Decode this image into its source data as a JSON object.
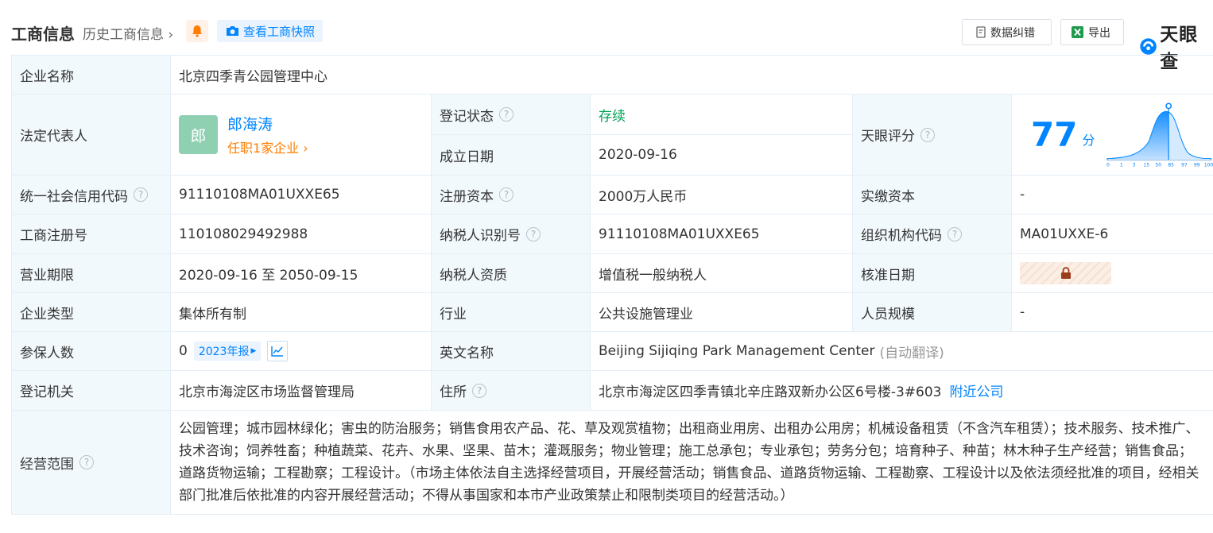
{
  "header": {
    "title": "工商信息",
    "history_link": "历史工商信息",
    "snapshot_label": "查看工商快照",
    "correct_label": "数据纠错",
    "export_label": "导出",
    "logo_text": "天眼查"
  },
  "company": {
    "name_label": "企业名称",
    "name": "北京四季青公园管理中心",
    "legal_rep_label": "法定代表人",
    "legal_rep_avatar": "郎",
    "legal_rep_name": "郎海涛",
    "legal_rep_positions": "任职1家企业",
    "status_label": "登记状态",
    "status": "存续",
    "established_label": "成立日期",
    "established": "2020-09-16",
    "score_label": "天眼评分",
    "score": "77",
    "score_unit": "分",
    "score_axis_ticks": [
      "0",
      "1",
      "3",
      "15",
      "50",
      "85",
      "97",
      "99",
      "100"
    ],
    "credit_code_label": "统一社会信用代码",
    "credit_code": "91110108MA01UXXE65",
    "reg_capital_label": "注册资本",
    "reg_capital": "2000万人民币",
    "paid_capital_label": "实缴资本",
    "paid_capital": "-",
    "reg_number_label": "工商注册号",
    "reg_number": "110108029492988",
    "taxpayer_id_label": "纳税人识别号",
    "taxpayer_id": "91110108MA01UXXE65",
    "org_code_label": "组织机构代码",
    "org_code": "MA01UXXE-6",
    "term_label": "营业期限",
    "term": "2020-09-16 至 2050-09-15",
    "taxpayer_type_label": "纳税人资质",
    "taxpayer_type": "增值税一般纳税人",
    "approval_date_label": "核准日期",
    "company_type_label": "企业类型",
    "company_type": "集体所有制",
    "industry_label": "行业",
    "industry": "公共设施管理业",
    "staff_size_label": "人员规模",
    "staff_size": "-",
    "insured_label": "参保人数",
    "insured": "0",
    "report_badge": "2023年报",
    "english_name_label": "英文名称",
    "english_name": "Beijing Sijiqing Park Management Center",
    "auto_translate": "(自动翻译)",
    "authority_label": "登记机关",
    "authority": "北京市海淀区市场监督管理局",
    "address_label": "住所",
    "address": "北京市海淀区四季青镇北辛庄路双新办公区6号楼-3#603",
    "nearby_link": "附近公司",
    "scope_label": "经营范围",
    "scope": "公园管理；城市园林绿化；害虫的防治服务；销售食用农产品、花、草及观赏植物；出租商业用房、出租办公用房；机械设备租赁（不含汽车租赁）；技术服务、技术推广、技术咨询；饲养牲畜；种植蔬菜、花卉、水果、坚果、苗木；灌溉服务；物业管理；施工总承包；专业承包；劳务分包；培育种子、种苗；林木种子生产经营；销售食品；道路货物运输；工程勘察；工程设计。（市场主体依法自主选择经营项目，开展经营活动；销售食品、道路货物运输、工程勘察、工程设计以及依法须经批准的项目，经相关部门批准后依批准的内容开展经营活动；不得从事国家和本市产业政策禁止和限制类项目的经营活动。）"
  }
}
